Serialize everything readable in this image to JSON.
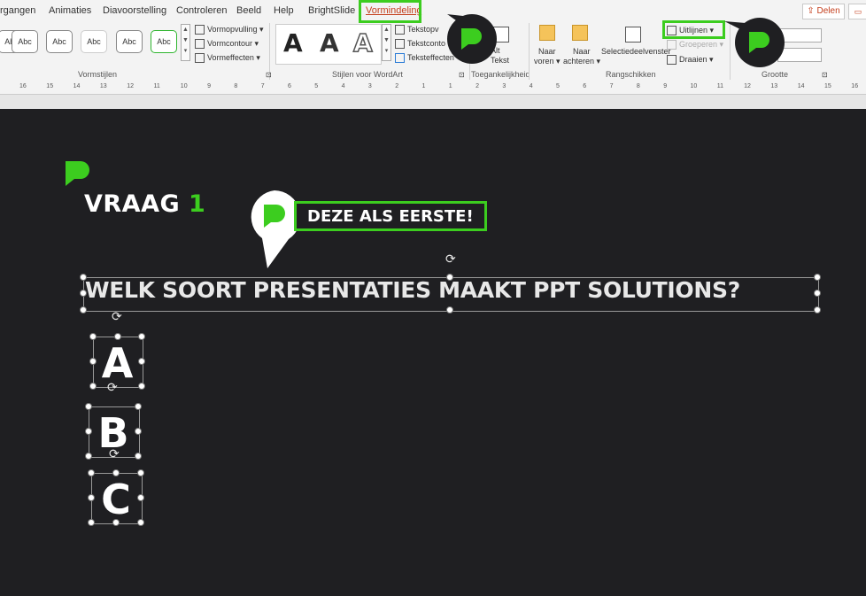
{
  "ribbon": {
    "tabs": [
      "rgangen",
      "Animaties",
      "Diavoorstelling",
      "Controleren",
      "Beeld",
      "Help",
      "BrightSlide",
      "Vormindeling"
    ],
    "active_tab": "Vormindeling",
    "share_label": "Delen",
    "comment_icon": "comment-icon",
    "vormstijlen": {
      "label": "Vormstijlen",
      "samples": [
        "Abc",
        "Abc",
        "Abc",
        "Abc",
        "Abc",
        "Abc"
      ],
      "opvulling": "Vormopvulling",
      "contour": "Vormcontour",
      "effecten": "Vormeffecten"
    },
    "wordart": {
      "label": "Stijlen voor WordArt",
      "samples": [
        "A",
        "A",
        "A"
      ],
      "opvulling": "Tekstopv",
      "contour": "Tekstconto",
      "effecten": "Teksteffecten"
    },
    "toegankelijkheid": {
      "label": "Toegankelijkheid",
      "alt": "Alt",
      "tekst": "Tekst"
    },
    "rangschikken": {
      "label": "Rangschikken",
      "naar_voren_1": "Naar",
      "naar_voren_2": "voren",
      "naar_achteren_1": "Naar",
      "naar_achteren_2": "achteren",
      "selectiedeelvenster": "Selectiedeelvenster",
      "uitlijnen": "Uitlijnen",
      "groeperen": "Groeperen",
      "draaien": "Draaien"
    },
    "grootte": {
      "label": "Grootte"
    }
  },
  "ruler": {
    "ticks": [
      "16",
      "15",
      "14",
      "13",
      "12",
      "11",
      "10",
      "9",
      "8",
      "7",
      "6",
      "5",
      "4",
      "3",
      "2",
      "1",
      "1",
      "2",
      "3",
      "4",
      "5",
      "6",
      "7",
      "8",
      "9",
      "10",
      "11",
      "12",
      "13",
      "14",
      "15",
      "16"
    ]
  },
  "slide": {
    "vraag_label": "VRAAG",
    "vraag_number": "1",
    "callout": "DEZE ALS EERSTE!",
    "question": "WELK SOORT PRESENTATIES MAAKT PPT SOLUTIONS?",
    "options": [
      "A",
      "B",
      "C"
    ]
  },
  "colors": {
    "accent_green": "#3ccd1f",
    "slide_bg": "#1f1f22",
    "active_tab": "#c43e1c"
  }
}
